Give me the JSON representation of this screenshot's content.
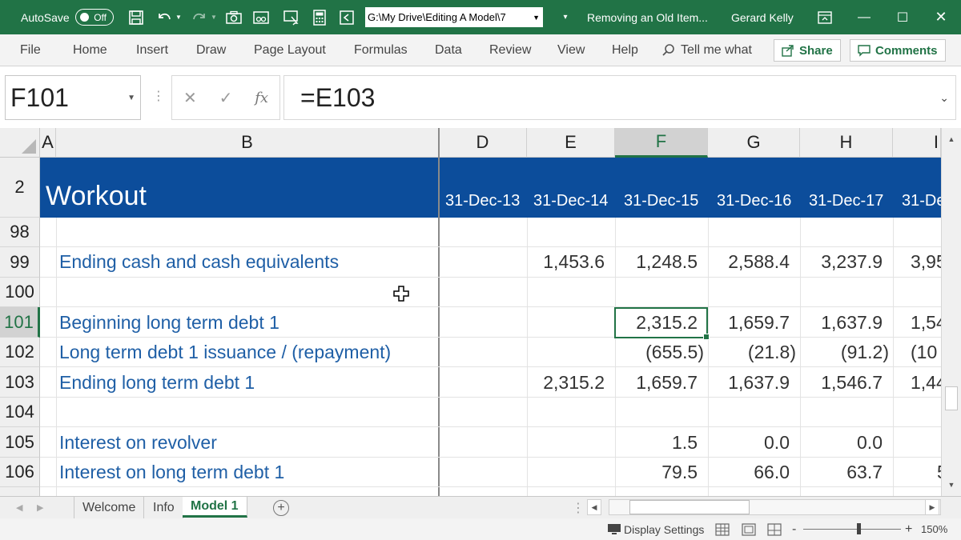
{
  "titlebar": {
    "autosave_label": "AutoSave",
    "autosave_state": "Off",
    "file_path": "G:\\My Drive\\Editing A Model\\7",
    "doc_title": "Removing an Old Item...",
    "user_name": "Gerard Kelly",
    "colors": {
      "bar": "#217346"
    }
  },
  "ribbon": {
    "tabs": [
      "File",
      "Home",
      "Insert",
      "Draw",
      "Page Layout",
      "Formulas",
      "Data",
      "Review",
      "View",
      "Help"
    ],
    "tell_me": "Tell me what",
    "share_label": "Share",
    "comments_label": "Comments"
  },
  "formula_bar": {
    "name_box": "F101",
    "fx_label": "fx",
    "formula": "=E103"
  },
  "grid": {
    "columns": [
      "A",
      "B",
      "D",
      "E",
      "F",
      "G",
      "H",
      "I"
    ],
    "selected_column": "F",
    "header_row_number": "2",
    "header_title": "Workout",
    "dates": [
      "31-Dec-13",
      "31-Dec-14",
      "31-Dec-15",
      "31-Dec-16",
      "31-Dec-17",
      "31-De"
    ],
    "header_color": "#0c4d9b",
    "rows": [
      {
        "num": "98",
        "label": "",
        "values": [
          "",
          "",
          "",
          "",
          "",
          ""
        ]
      },
      {
        "num": "99",
        "label": "Ending cash and cash equivalents",
        "values": [
          "",
          "1,453.6",
          "1,248.5",
          "2,588.4",
          "3,237.9",
          "3,95"
        ]
      },
      {
        "num": "100",
        "label": "",
        "values": [
          "",
          "",
          "",
          "",
          "",
          ""
        ]
      },
      {
        "num": "101",
        "label": "Beginning long term debt 1",
        "values": [
          "",
          "",
          "2,315.2",
          "1,659.7",
          "1,637.9",
          "1,54"
        ]
      },
      {
        "num": "102",
        "label": "Long term debt 1 issuance / (repayment)",
        "values": [
          "",
          "",
          "(655.5)",
          "(21.8)",
          "(91.2)",
          "(10"
        ]
      },
      {
        "num": "103",
        "label": "Ending long term debt 1",
        "values": [
          "",
          "2,315.2",
          "1,659.7",
          "1,637.9",
          "1,546.7",
          "1,44"
        ]
      },
      {
        "num": "104",
        "label": "",
        "values": [
          "",
          "",
          "",
          "",
          "",
          ""
        ]
      },
      {
        "num": "105",
        "label": "Interest on revolver",
        "values": [
          "",
          "",
          "1.5",
          "0.0",
          "0.0",
          ""
        ]
      },
      {
        "num": "106",
        "label": "Interest on long term debt 1",
        "values": [
          "",
          "",
          "79.5",
          "66.0",
          "63.7",
          "5"
        ]
      }
    ],
    "selected_row": "101",
    "label_color": "#1f5fa6"
  },
  "sheets": {
    "tabs": [
      "Welcome",
      "Info",
      "Model 1"
    ],
    "active": "Model 1"
  },
  "statusbar": {
    "display_settings": "Display Settings",
    "zoom_minus": "-",
    "zoom_plus": "+",
    "zoom": "150%",
    "zoom_level": 150
  }
}
